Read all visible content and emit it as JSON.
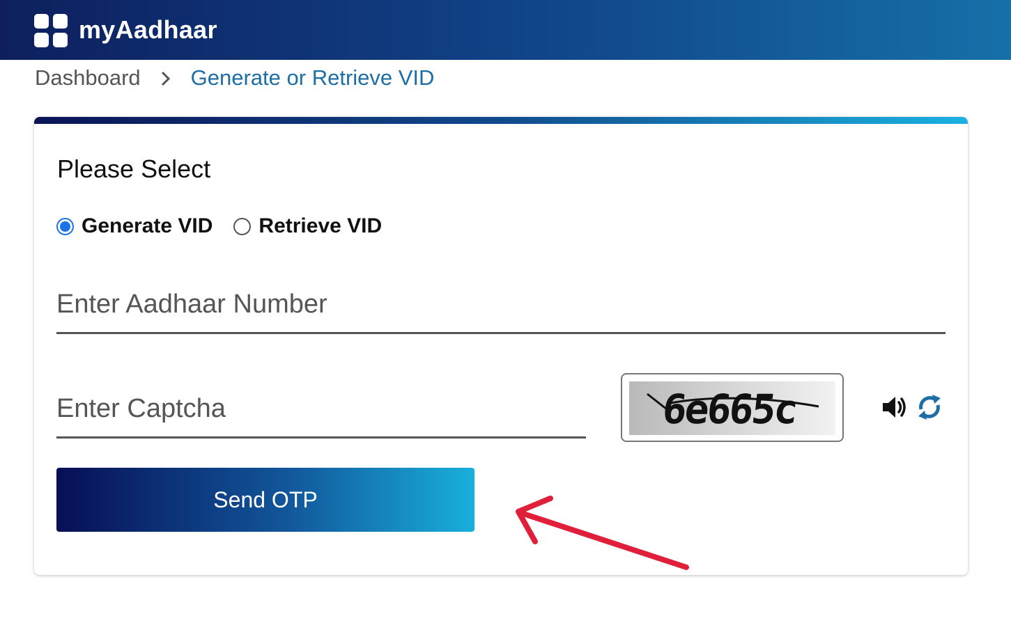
{
  "header": {
    "brand": "myAadhaar",
    "logo_icon": "apps-grid-icon"
  },
  "breadcrumb": {
    "home": "Dashboard",
    "current": "Generate or Retrieve VID"
  },
  "form": {
    "heading": "Please Select",
    "options": [
      {
        "label": "Generate VID",
        "selected": true
      },
      {
        "label": "Retrieve VID",
        "selected": false
      }
    ],
    "aadhaar_placeholder": "Enter Aadhaar Number",
    "captcha_placeholder": "Enter Captcha",
    "captcha_code": "6e665c",
    "send_label": "Send OTP"
  },
  "colors": {
    "accent": "#1c6ea4",
    "radio": "#1a73e8",
    "annotation_arrow": "#e0203a"
  }
}
